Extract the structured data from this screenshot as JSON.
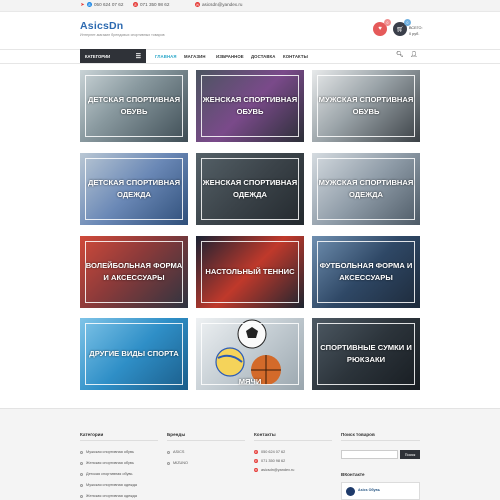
{
  "topbar": {
    "phone1": "050 624 07 62",
    "phone2": "071 350 98 62",
    "email": "asicsdn@yandex.ru"
  },
  "header": {
    "logo": "AsicsDn",
    "slogan": "Интернет-магазин брендовых спортивных товаров",
    "favorites_count": "0",
    "cart_count": "0",
    "total_label": "ВСЕГО:",
    "total_value": "0 руб."
  },
  "nav": {
    "categories_label": "КАТЕГОРИИ",
    "items": [
      "ГЛАВНАЯ",
      "МАГАЗИН",
      "ИЗБРАННОЕ",
      "ДОСТАВКА",
      "КОНТАКТЫ"
    ]
  },
  "categories": [
    {
      "label": "Детская спортивная обувь"
    },
    {
      "label": "Женская спортивная обувь"
    },
    {
      "label": "Мужская спортивная обувь"
    },
    {
      "label": "Детская спортивная одежда"
    },
    {
      "label": "Женская спортивная одежда"
    },
    {
      "label": "Мужская спортивная одежда"
    },
    {
      "label": "Волейбольная форма и аксессуары"
    },
    {
      "label": "Настольный теннис"
    },
    {
      "label": "Футбольная форма и аксессуары"
    },
    {
      "label": "Другие виды спорта"
    },
    {
      "label": "Мячи"
    },
    {
      "label": "Спортивные сумки и рюкзаки"
    }
  ],
  "footer": {
    "categories_title": "Категории",
    "categories": [
      "Мужская спортивная обувь",
      "Женская спортивная обувь",
      "Детская спортивная обувь",
      "Мужская спортивная одежда",
      "Женская спортивная одежда"
    ],
    "brands_title": "Бренды",
    "brands": [
      "ASICS",
      "MIZUNO"
    ],
    "contacts_title": "Контакты",
    "contacts": [
      "050 624 07 62",
      "071 350 98 62",
      "asicsdn@yandex.ru"
    ],
    "search_title": "Поиск товаров",
    "search_placeholder": "",
    "search_button": "Поиск",
    "vk_title": "ВКонтакте",
    "vk_name": "Asics Обувь"
  },
  "colors": {
    "accent": "#2aa7c9",
    "brand": "#2d6ab0",
    "dark": "#2f3238",
    "favorite": "#e55a5a"
  }
}
